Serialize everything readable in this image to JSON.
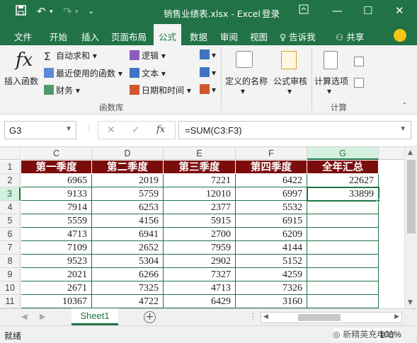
{
  "window": {
    "title": "销售业绩表.xlsx - Excel",
    "login_label": "登录"
  },
  "ribbon_tabs": [
    {
      "label": "文件",
      "active": false
    },
    {
      "label": "开始",
      "active": false
    },
    {
      "label": "插入",
      "active": false
    },
    {
      "label": "页面布局",
      "active": false
    },
    {
      "label": "公式",
      "active": true
    },
    {
      "label": "数据",
      "active": false
    },
    {
      "label": "审阅",
      "active": false
    },
    {
      "label": "视图",
      "active": false
    }
  ],
  "tell_me": "告诉我",
  "share": "共享",
  "ribbon": {
    "insert_function": "插入函数",
    "fx_symbol": "fx",
    "autosum": "自动求和",
    "recently_used": "最近使用的函数",
    "financial": "财务",
    "logical": "逻辑",
    "text": "文本",
    "date_time": "日期和时间",
    "defined_names": "定义的名称",
    "formula_auditing": "公式审核",
    "calc_options": "计算选项",
    "group_function_library": "函数库",
    "group_calculation": "计算"
  },
  "formula_bar": {
    "name_box": "G3",
    "cancel_symbol": "✕",
    "enter_symbol": "✓",
    "fx_symbol": "fx",
    "formula": "=SUM(C3:F3)"
  },
  "columns": [
    "C",
    "D",
    "E",
    "F",
    "G"
  ],
  "rows": [
    "1",
    "2",
    "3",
    "4",
    "5",
    "6",
    "7",
    "8",
    "9",
    "10",
    "11"
  ],
  "table": {
    "headers": [
      "第一季度",
      "第二季度",
      "第三季度",
      "第四季度",
      "全年汇总"
    ],
    "data": [
      [
        "6965",
        "2019",
        "7221",
        "6422",
        "22627"
      ],
      [
        "9133",
        "5759",
        "12010",
        "6997",
        "33899"
      ],
      [
        "7914",
        "6253",
        "2377",
        "5532",
        ""
      ],
      [
        "5559",
        "4156",
        "5915",
        "6915",
        ""
      ],
      [
        "4713",
        "6941",
        "2700",
        "6209",
        ""
      ],
      [
        "7109",
        "2652",
        "7959",
        "4144",
        ""
      ],
      [
        "9523",
        "5304",
        "2902",
        "5152",
        ""
      ],
      [
        "2021",
        "6266",
        "7327",
        "4259",
        ""
      ],
      [
        "2671",
        "7325",
        "4713",
        "7326",
        ""
      ],
      [
        "10367",
        "4722",
        "6429",
        "3160",
        ""
      ]
    ]
  },
  "sheet_tab": "Sheet1",
  "status": {
    "ready": "就绪",
    "watermark": "新精英充电站",
    "zoom": "100%"
  },
  "colors": {
    "excel_green": "#217346",
    "header_fill": "#7b0d0d"
  }
}
